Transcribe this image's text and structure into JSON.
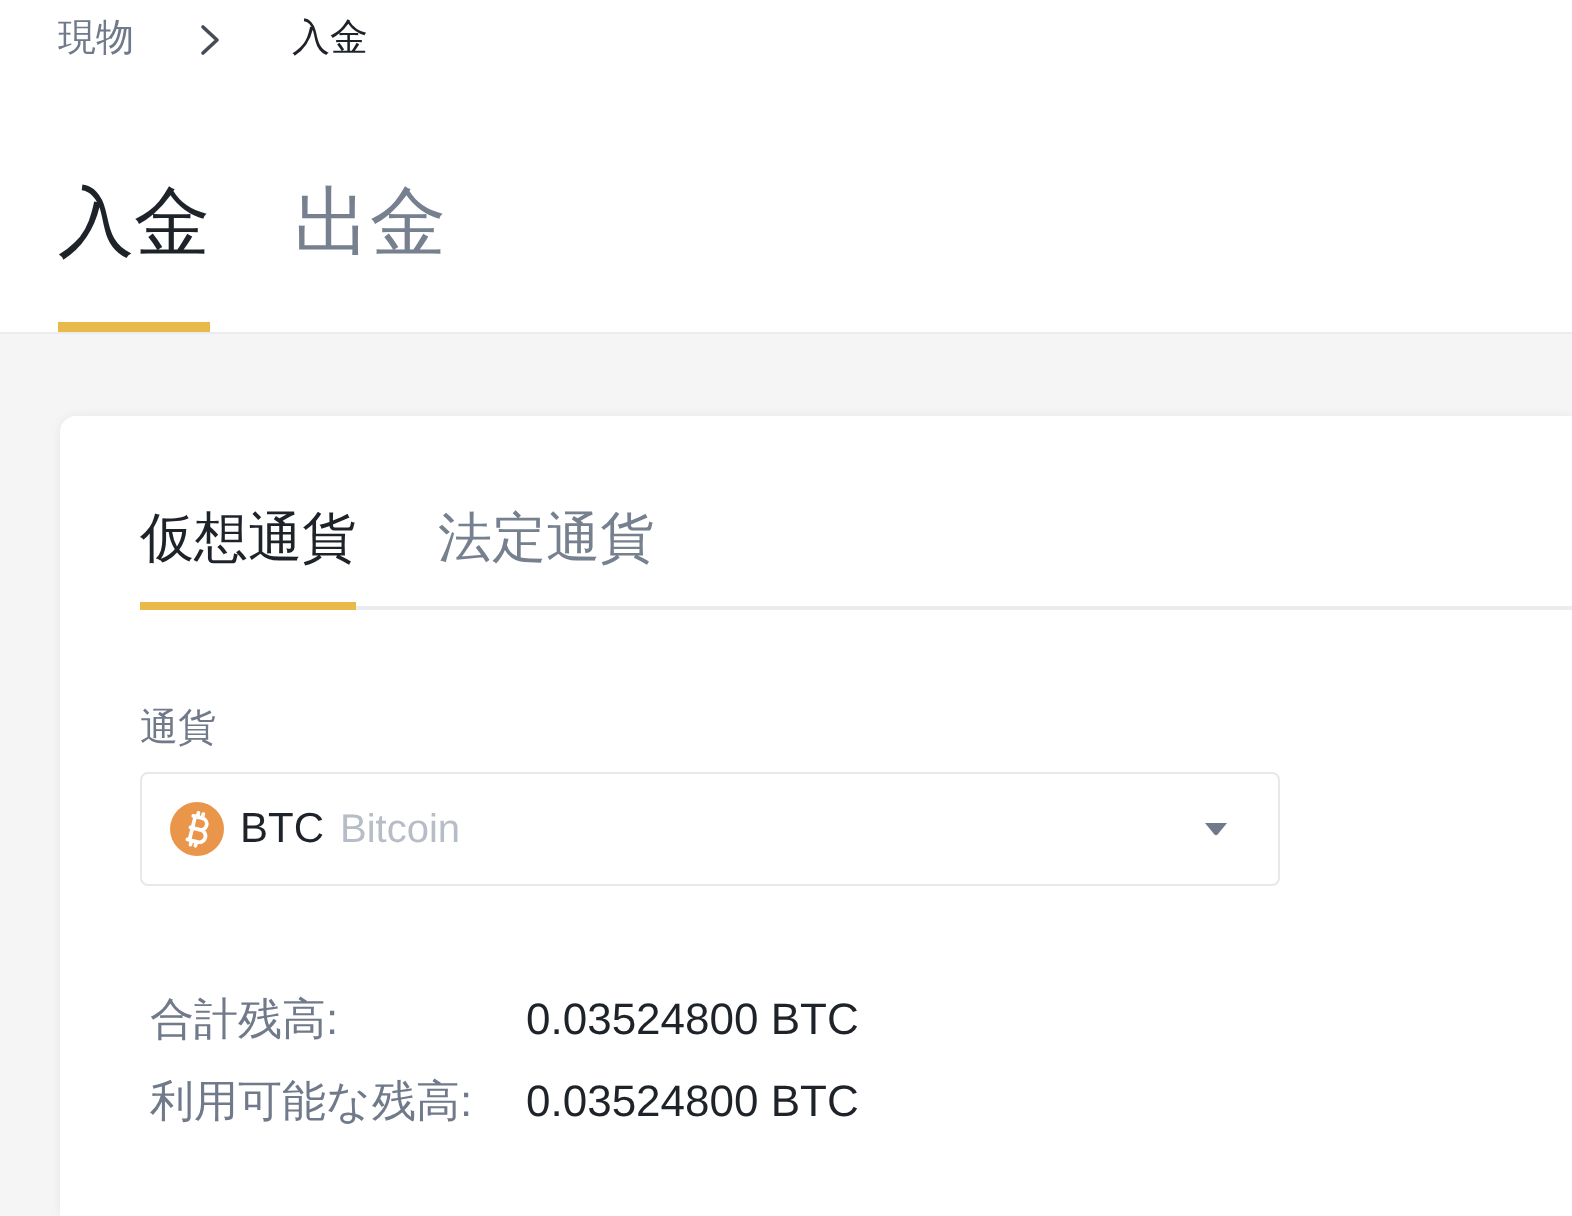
{
  "breadcrumb": [
    {
      "label": "現物",
      "current": false
    },
    {
      "label": "入金",
      "current": true
    }
  ],
  "page_tabs": [
    {
      "label": "入金",
      "selected": true
    },
    {
      "label": "出金",
      "selected": false
    }
  ],
  "card": {
    "tabs": [
      {
        "label": "仮想通貨",
        "selected": true
      },
      {
        "label": "法定通貨",
        "selected": false
      }
    ],
    "currency_field": {
      "label": "通貨",
      "symbol": "BTC",
      "name": "Bitcoin"
    },
    "balances": [
      {
        "label": "合計残高:",
        "value": "0.03524800 BTC"
      },
      {
        "label": "利用可能な残高:",
        "value": "0.03524800 BTC"
      }
    ]
  }
}
